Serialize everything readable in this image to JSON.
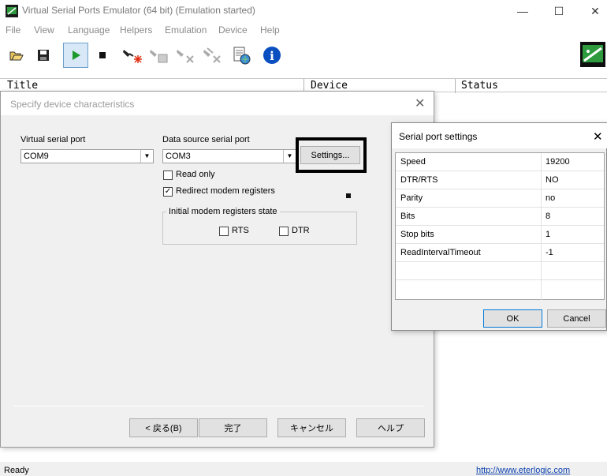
{
  "app": {
    "title": "Virtual Serial Ports Emulator (64 bit) (Emulation started)",
    "window_controls": {
      "minimize": "—",
      "maximize": "☐",
      "close": "✕"
    }
  },
  "menu": [
    "File",
    "View",
    "Language",
    "Helpers",
    "Emulation",
    "Device",
    "Help"
  ],
  "toolbar": {
    "icons": [
      "open-icon",
      "save-icon",
      "play-icon",
      "stop-icon",
      "new-device-icon",
      "device-settings-icon",
      "remove-device-icon",
      "remove-all-devices-icon",
      "log-icon",
      "info-icon",
      "plugin-icon"
    ],
    "info_glyph": "i"
  },
  "listview": {
    "columns": [
      "Title",
      "Device",
      "Status"
    ]
  },
  "wizard": {
    "title": "Specify device characteristics",
    "close": "✕",
    "virtual_port_label": "Virtual serial port",
    "virtual_port_value": "COM9",
    "data_source_label": "Data source serial port",
    "data_source_value": "COM3",
    "settings_button": "Settings...",
    "read_only_label": "Read only",
    "read_only_checked": false,
    "redirect_label": "Redirect modem registers",
    "redirect_checked": true,
    "check_mark": "✓",
    "group_title": "Initial modem registers state",
    "rts_label": "RTS",
    "dtr_label": "DTR",
    "buttons": {
      "back": "< 戻る(B)",
      "finish": "完了",
      "cancel": "キャンセル",
      "help": "ヘルプ"
    }
  },
  "serial_settings": {
    "title": "Serial port settings",
    "close": "✕",
    "rows": [
      {
        "key": "Speed",
        "value": "19200"
      },
      {
        "key": "DTR/RTS",
        "value": "NO"
      },
      {
        "key": "Parity",
        "value": "no"
      },
      {
        "key": "Bits",
        "value": "8"
      },
      {
        "key": "Stop bits",
        "value": "1"
      },
      {
        "key": "ReadIntervalTimeout",
        "value": "-1"
      }
    ],
    "ok_button": "OK",
    "cancel_button": "Cancel"
  },
  "status": {
    "text": "Ready",
    "link": "http://www.eterlogic.com"
  },
  "colors": {
    "accent_blue": "#0b3fae",
    "play_green": "#1c9a2c",
    "info_blue": "#0a4fbf"
  }
}
